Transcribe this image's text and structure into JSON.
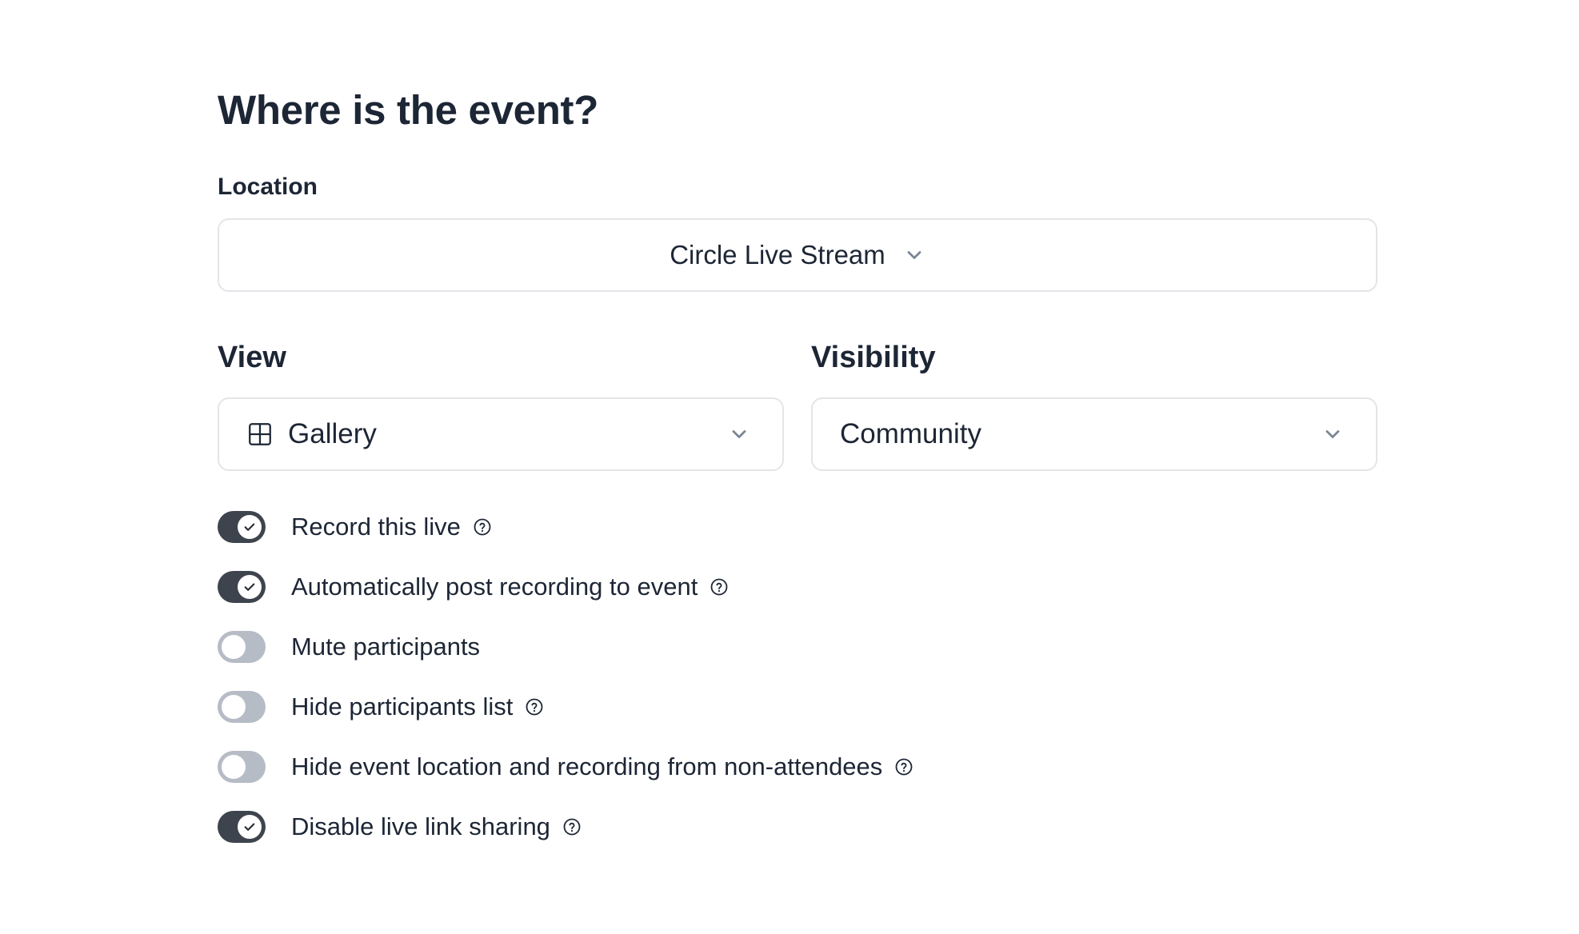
{
  "page_title": "Where is the event?",
  "location": {
    "label": "Location",
    "value": "Circle Live Stream",
    "icon": "chevron-down-icon"
  },
  "view": {
    "label": "View",
    "value": "Gallery",
    "icon": "gallery-grid-icon"
  },
  "visibility": {
    "label": "Visibility",
    "value": "Community"
  },
  "toggles": [
    {
      "label": "Record this live",
      "on": true,
      "help": true
    },
    {
      "label": "Automatically post recording to event",
      "on": true,
      "help": true
    },
    {
      "label": "Mute participants",
      "on": false,
      "help": false
    },
    {
      "label": "Hide participants list",
      "on": false,
      "help": true
    },
    {
      "label": "Hide event location and recording from non-attendees",
      "on": false,
      "help": true
    },
    {
      "label": "Disable live link sharing",
      "on": true,
      "help": true
    }
  ],
  "colors": {
    "text": "#1d2635",
    "toggle_on": "#3e444d",
    "toggle_off": "#b6bcc6",
    "border": "#e3e5e8"
  }
}
